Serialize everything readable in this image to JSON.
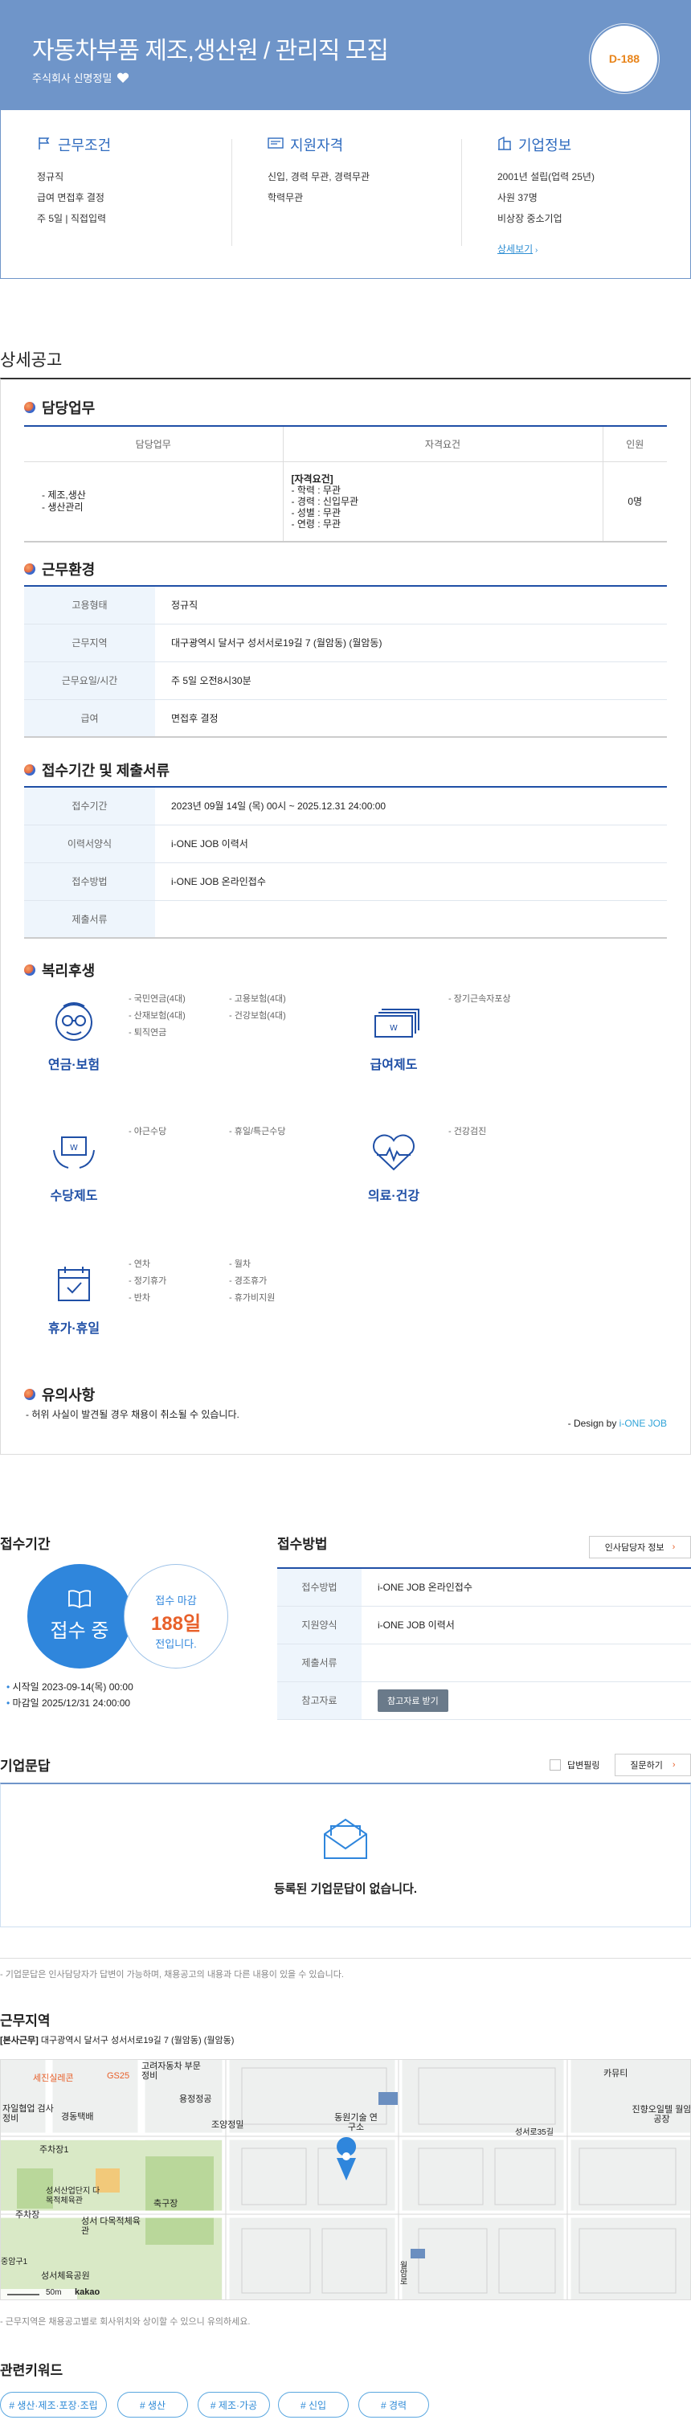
{
  "hero": {
    "title": "자동차부품 제조,생산원 / 관리직 모집",
    "company": "주식회사 신명정밀",
    "dday": "D-188"
  },
  "summary": {
    "work": {
      "title": "근무조건",
      "lines": [
        "정규직",
        "급여 면접후 결정",
        "주 5일 | 직접입력"
      ]
    },
    "qual": {
      "title": "지원자격",
      "lines": [
        "신입, 경력 무관, 경력무관",
        "학력무관"
      ]
    },
    "company": {
      "title": "기업정보",
      "lines": [
        "2001년 설립(업력 25년)",
        "사원 37명",
        "비상장 중소기업"
      ],
      "link": "상세보기"
    }
  },
  "detail": {
    "title": "상세공고",
    "duty": {
      "title": "담당업무",
      "headers": [
        "담당업무",
        "자격요건",
        "인원"
      ],
      "task": [
        "- 제조,생산",
        "- 생산관리"
      ],
      "req_head": "[자격요건]",
      "req": [
        "- 학력 : 무관",
        "- 경력 : 신입무관",
        "- 성별 : 무관",
        "- 연령 : 무관"
      ],
      "count": "0명"
    },
    "env": {
      "title": "근무환경",
      "rows": [
        [
          "고용형태",
          "정규직"
        ],
        [
          "근무지역",
          "대구광역시 달서구 성서서로19길 7 (월암동) (월암동)"
        ],
        [
          "근무요일/시간",
          "주 5일 오전8시30분"
        ],
        [
          "급여",
          "면접후 결정"
        ]
      ]
    },
    "period": {
      "title": "접수기간 및 제출서류",
      "rows": [
        [
          "접수기간",
          "2023년 09월 14일 (목) 00시 ~ 2025.12.31 24:00:00"
        ],
        [
          "이력서양식",
          "i-ONE JOB 이력서"
        ],
        [
          "접수방법",
          "i-ONE JOB 온라인접수"
        ],
        [
          "제출서류",
          ""
        ]
      ]
    },
    "welfare": {
      "title": "복리후생",
      "items": [
        {
          "label": "연금·보험",
          "list1": [
            "- 국민연금(4대)",
            "- 산재보험(4대)",
            "- 퇴직연금"
          ],
          "list2": [
            "- 고용보험(4대)",
            "- 건강보험(4대)"
          ]
        },
        {
          "label": "급여제도",
          "list1": [
            "- 장기근속자포상"
          ],
          "list2": []
        },
        {
          "label": "수당제도",
          "list1": [
            "- 야근수당"
          ],
          "list2": [
            "- 휴일/특근수당"
          ]
        },
        {
          "label": "의료·건강",
          "list1": [
            "- 건강검진"
          ],
          "list2": []
        },
        {
          "label": "휴가·휴일",
          "list1": [
            "- 연차",
            "- 정기휴가",
            "- 반차"
          ],
          "list2": [
            "- 월차",
            "- 경조휴가",
            "- 휴가비지원"
          ]
        }
      ]
    },
    "caution": {
      "title": "유의사항",
      "text": "- 허위 사실이 발견될 경우 채용이 취소될 수 있습니다."
    },
    "design_prefix": "- Design by ",
    "design_brand": "i-ONE JOB"
  },
  "apply": {
    "period_title": "접수기간",
    "status": "접수 중",
    "deadline_label": "접수 마감",
    "deadline_days": "188일",
    "deadline_suffix": "전입니다.",
    "start": "시작일 2023-09-14(목) 00:00",
    "end": "마감일 2025/12/31 24:00:00",
    "method_title": "접수방법",
    "manager_btn": "인사담당자 정보",
    "rows": [
      [
        "접수방법",
        "i-ONE JOB 온라인접수"
      ],
      [
        "지원양식",
        "i-ONE JOB 이력서"
      ],
      [
        "제출서류",
        ""
      ],
      [
        "참고자료",
        ""
      ]
    ],
    "ref_btn": "참고자료 받기"
  },
  "qa": {
    "title": "기업문답",
    "answered": "답변필링",
    "ask_btn": "질문하기",
    "empty": "등록된 기업문답이 없습니다.",
    "note": "- 기업문답은 인사담당자가 답변이 가능하며, 채용공고의 내용과 다른 내용이 있을 수 있습니다."
  },
  "location": {
    "title": "근무지역",
    "tag": "[본사근무]",
    "address": "대구광역시 달서구 성서서로19길 7 (월암동) (월암동)",
    "note": "- 근무지역은 채용공고별로 회사위치와 상이할 수 있으니 유의하세요.",
    "map_labels": [
      "세진실레콘",
      "GS25",
      "고려자동차 부문정비",
      "용정정공",
      "카뮤티",
      "자일협업 검사정비",
      "경동택배",
      "진향오일텔 월암공장",
      "조양정밀",
      "동원기술 연구소",
      "주차장1",
      "성서산업단지 다목적체육관",
      "축구장",
      "주차장",
      "성서 다목적체육관",
      "성서체육공원",
      "중암구1",
      "성서로35길",
      "월암로",
      "50m",
      "kakao"
    ]
  },
  "keywords": {
    "title": "관련키워드",
    "items": [
      "# 생산·제조·포장·조립",
      "# 생산",
      "# 제조·가공",
      "# 신입",
      "# 경력"
    ]
  }
}
